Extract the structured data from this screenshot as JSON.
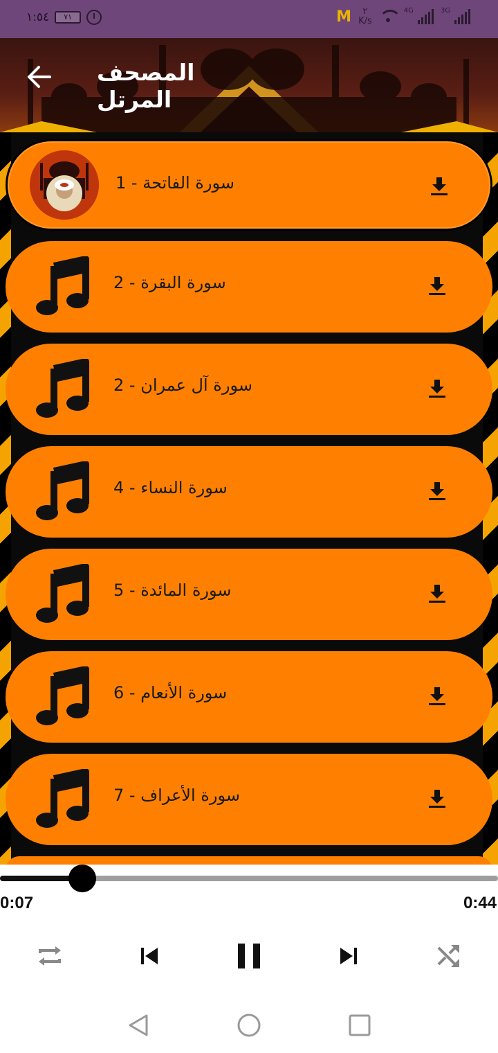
{
  "status_bar": {
    "time": "١:٥٤",
    "battery": "٧١",
    "speed_value": "٢",
    "speed_unit": "K/s",
    "net1": "4G",
    "net2": "3G",
    "icons": [
      "alarm-icon",
      "wifi-icon",
      "signal-icon"
    ]
  },
  "header": {
    "title": "المصحف المرتل",
    "back_icon": "arrow-left-icon"
  },
  "colors": {
    "status_bar": "#6f467a",
    "row_fill": "#ff8000",
    "stripe": "#f5a300",
    "accent_dark": "#000000"
  },
  "tracks": [
    {
      "label": "سورة الفاتحة  - 1",
      "icon": "reciter-avatar",
      "active": true
    },
    {
      "label": "سورة البقرة - 2",
      "icon": "music-note-icon",
      "active": false
    },
    {
      "label": "سورة آل عمران - 2",
      "icon": "music-note-icon",
      "active": false
    },
    {
      "label": "سورة النساء - 4",
      "icon": "music-note-icon",
      "active": false
    },
    {
      "label": "سورة المائدة - 5",
      "icon": "music-note-icon",
      "active": false
    },
    {
      "label": "سورة الأنعام - 6",
      "icon": "music-note-icon",
      "active": false
    },
    {
      "label": "سورة الأعراف - 7",
      "icon": "music-note-icon",
      "active": false
    }
  ],
  "player": {
    "current_time": "0:07",
    "duration": "0:44",
    "progress_fraction": 0.165,
    "controls": [
      "repeat-icon",
      "previous-icon",
      "pause-icon",
      "next-icon",
      "shuffle-icon"
    ]
  },
  "nav": [
    "back-triangle-icon",
    "home-circle-icon",
    "recents-square-icon"
  ]
}
